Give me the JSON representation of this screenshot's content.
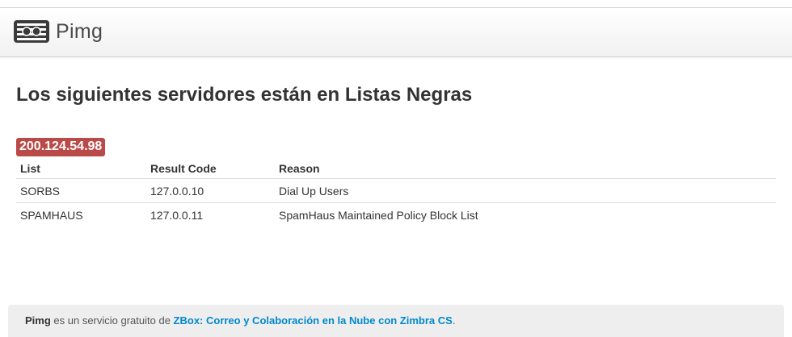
{
  "brand": {
    "name": "Pimg",
    "icon": "pimg-logo-icon"
  },
  "title": "Los siguientes servidores están en Listas Negras",
  "servers": [
    {
      "ip": "200.124.54.98",
      "columns": [
        "List",
        "Result Code",
        "Reason"
      ],
      "rows": [
        {
          "list": "SORBS",
          "code": "127.0.0.10",
          "reason": "Dial Up Users"
        },
        {
          "list": "SPAMHAUS",
          "code": "127.0.0.11",
          "reason": "SpamHaus Maintained Policy Block List"
        }
      ]
    }
  ],
  "footer": {
    "brand": "Pimg",
    "text": " es un servicio gratuito de ",
    "link": "ZBox: Correo y Colaboración en la Nube con Zimbra CS",
    "suffix": "."
  },
  "colors": {
    "badge": "#b94a48",
    "link": "#0088cc",
    "footer_bg": "#eeeeee"
  }
}
